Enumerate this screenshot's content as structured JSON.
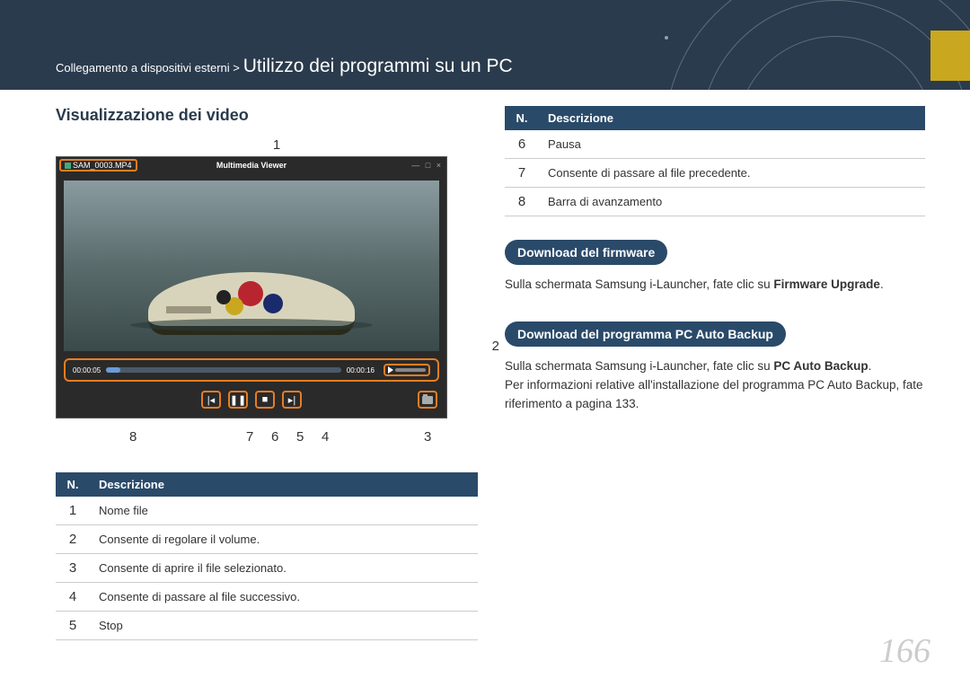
{
  "breadcrumb": {
    "small": "Collegamento a dispositivi esterni >",
    "big": "Utilizzo dei programmi su un PC"
  },
  "left": {
    "heading": "Visualizzazione dei video",
    "callouts": {
      "c1": "1",
      "c2": "2",
      "c3": "3",
      "c4": "4",
      "c5": "5",
      "c6": "6",
      "c7": "7",
      "c8": "8"
    },
    "player": {
      "filename": "SAM_0003.MP4",
      "title": "Multimedia Viewer",
      "time_left": "00:00:05",
      "time_right": "00:00:16"
    },
    "table": {
      "h1": "N.",
      "h2": "Descrizione",
      "rows": [
        {
          "n": "1",
          "d": "Nome file"
        },
        {
          "n": "2",
          "d": "Consente di regolare il volume."
        },
        {
          "n": "3",
          "d": "Consente di aprire il file selezionato."
        },
        {
          "n": "4",
          "d": "Consente di passare al file successivo."
        },
        {
          "n": "5",
          "d": "Stop"
        }
      ]
    }
  },
  "right": {
    "table": {
      "h1": "N.",
      "h2": "Descrizione",
      "rows": [
        {
          "n": "6",
          "d": "Pausa"
        },
        {
          "n": "7",
          "d": "Consente di passare al file precedente."
        },
        {
          "n": "8",
          "d": "Barra di avanzamento"
        }
      ]
    },
    "pill1": "Download del firmware",
    "body1_a": "Sulla schermata Samsung i-Launcher, fate clic su ",
    "body1_b": "Firmware Upgrade",
    "body1_c": ".",
    "pill2": "Download del programma PC Auto Backup",
    "body2_a": "Sulla schermata Samsung i-Launcher, fate clic su ",
    "body2_b": "PC Auto Backup",
    "body2_c": ".",
    "body2_d": "Per informazioni relative all'installazione del programma PC Auto Backup, fate riferimento a pagina 133."
  },
  "pageNumber": "166"
}
